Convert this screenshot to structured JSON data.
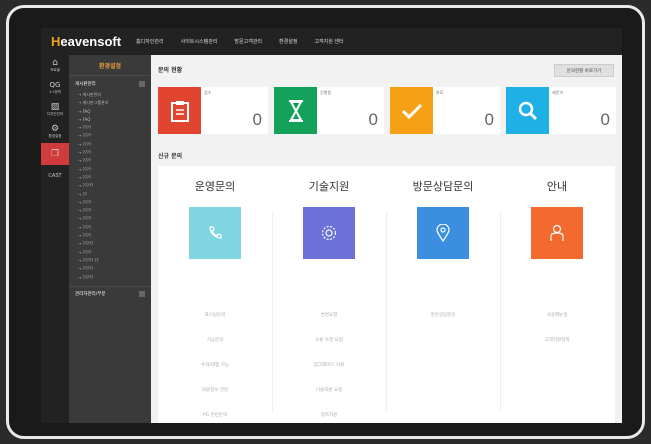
{
  "brand": {
    "logo_first": "H",
    "logo_rest": "eavensoft"
  },
  "nav": [
    "홈디자인관리",
    "사이트시스템관리",
    "방문고객관리",
    "환경설정",
    "고객지원 센터"
  ],
  "iconbar": [
    {
      "icon": "store-icon",
      "label": "프로필",
      "glyph": "⌂"
    },
    {
      "icon": "qna-icon",
      "label": "1:1문의",
      "glyph": "QG"
    },
    {
      "icon": "image-icon",
      "label": "디자인관리",
      "glyph": "▨"
    },
    {
      "icon": "settings-icon",
      "label": "환경설정",
      "glyph": "⚙"
    },
    {
      "icon": "cast-icon",
      "label": "",
      "glyph": "❐"
    },
    {
      "icon": "",
      "label": "CAST",
      "glyph": ""
    }
  ],
  "sidebar": {
    "title": "환경설정",
    "group1": "게시판관리",
    "items": [
      "→ 게시판관리",
      "→ 게시판그룹관리",
      "→ FAQ",
      "→ FAQ",
      "→ ????",
      "→ ????",
      "→ ????",
      "→ ????",
      "→ ????",
      "→ ????",
      "→ ????",
      "→ ?????",
      "→ ??",
      "→ ????",
      "→ ????",
      "→ ????",
      "→ ????",
      "→ ????",
      "→ ?????",
      "→ ????",
      "→ ????? ??",
      "→ ?????",
      "→ ?????"
    ],
    "group2": "관리자관리/부분"
  },
  "main": {
    "status_title": "문의 현황",
    "status_button": "문의현황 바로가기",
    "cards": [
      {
        "label": "접수",
        "count": "0",
        "color": "#e2452f",
        "icon": "clipboard-icon"
      },
      {
        "label": "진행중",
        "count": "0",
        "color": "#14a15a",
        "icon": "hourglass-icon"
      },
      {
        "label": "완료",
        "count": "0",
        "color": "#f5a015",
        "icon": "check-icon"
      },
      {
        "label": "재문의",
        "count": "0",
        "color": "#1fb1e6",
        "icon": "search-icon"
      }
    ],
    "new_title": "신규 문의",
    "columns": [
      {
        "title": "운영문의",
        "color": "#7fd6e0",
        "icon": "phone-icon",
        "items": [
          "표스팅문의",
          "기능문의",
          "투자/대행 기능",
          "회원정보 관련",
          "PG 관련문의"
        ]
      },
      {
        "title": "기술지원",
        "color": "#6b71d6",
        "icon": "gear-icon",
        "items": [
          "변경요청",
          "오류 수정 요청",
          "업그레이드 지원",
          "기술지원 요청",
          "접속지원"
        ]
      },
      {
        "title": "방문상담문의",
        "color": "#3c8fe0",
        "icon": "location-icon",
        "items": [
          "방문상담문의"
        ]
      },
      {
        "title": "안내",
        "color": "#f26a2e",
        "icon": "info-icon",
        "items": [
          "사용매뉴얼",
          "고객지원정책"
        ]
      }
    ]
  }
}
